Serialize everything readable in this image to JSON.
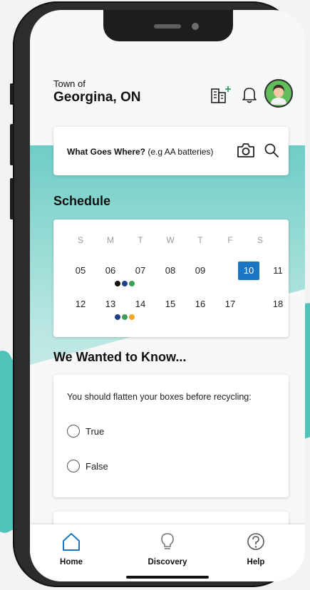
{
  "header": {
    "town_prefix": "Town of",
    "town_name": "Georgina, ON"
  },
  "search": {
    "label_bold": "What Goes Where?",
    "hint": "(e.g AA batteries)"
  },
  "schedule": {
    "title": "Schedule",
    "weekdays": [
      "S",
      "M",
      "T",
      "W",
      "T",
      "F",
      "S"
    ],
    "week1": [
      "05",
      "06",
      "07",
      "08",
      "09",
      "10",
      "11"
    ],
    "week2": [
      "12",
      "13",
      "14",
      "15",
      "16",
      "17",
      "18"
    ],
    "selected_date": "10",
    "dots_06": [
      "#111111",
      "#1f3f8f",
      "#3aa05a"
    ],
    "dots_13": [
      "#1f3f8f",
      "#3aa05a",
      "#f5a623"
    ]
  },
  "quiz": {
    "title": "We Wanted to Know...",
    "question": "You should flatten your boxes before recycling:",
    "options": [
      "True",
      "False"
    ]
  },
  "tabs": [
    {
      "label": "Home",
      "icon": "home-icon"
    },
    {
      "label": "Discovery",
      "icon": "lightbulb-icon"
    },
    {
      "label": "Help",
      "icon": "help-icon"
    }
  ],
  "colors": {
    "accent_blue": "#1a76c2",
    "teal": "#4fc2b9"
  }
}
